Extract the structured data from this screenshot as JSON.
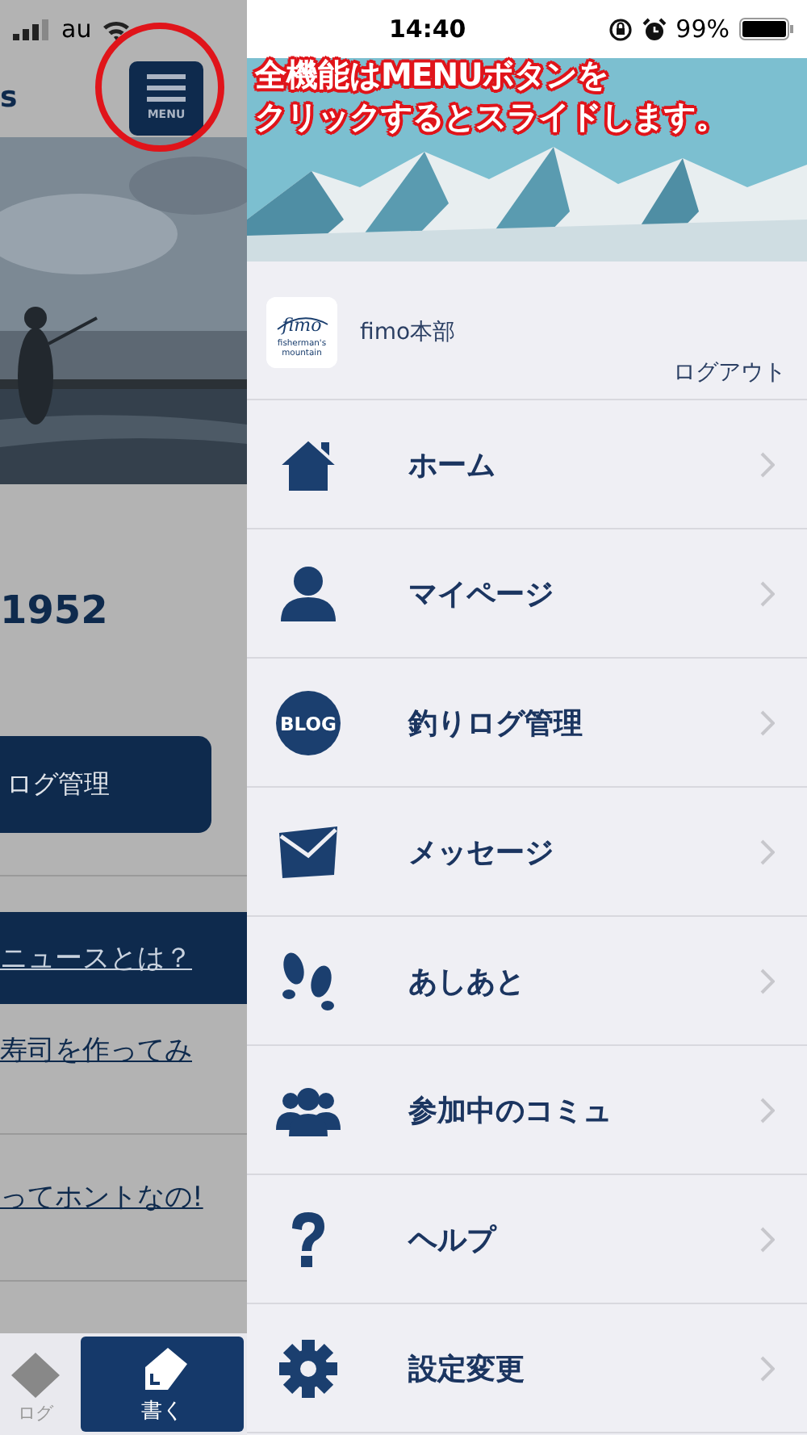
{
  "status_bar": {
    "carrier": "au",
    "time": "14:40",
    "battery": "99%"
  },
  "back_page": {
    "header_title": "s",
    "menu_button": "MENU",
    "number": "1952",
    "log_button": "ログ管理",
    "links": [
      {
        "text": "ニュースとは？",
        "highlighted": true
      },
      {
        "text": "寿司を作ってみ",
        "highlighted": false
      },
      {
        "text": "ってホントなの!",
        "highlighted": false
      }
    ],
    "tabs": [
      {
        "label": "ログ",
        "selected": false
      },
      {
        "label": "書く",
        "selected": true
      }
    ]
  },
  "annotation": {
    "lines": [
      "全機能はMENUボタンを",
      "クリックするとスライドします。"
    ]
  },
  "menu": {
    "logo": {
      "name": "fimo",
      "tagline": [
        "fisherman's",
        "mountain"
      ]
    },
    "user": "fimo本部",
    "logout": "ログアウト",
    "items": [
      {
        "label": "ホーム",
        "kind": "home"
      },
      {
        "label": "マイページ",
        "kind": "person"
      },
      {
        "label": "釣りログ管理",
        "kind": "badge",
        "icon_text": "BLOG"
      },
      {
        "label": "メッセージ",
        "kind": "envelope"
      },
      {
        "label": "あしあと",
        "kind": "footprints"
      },
      {
        "label": "参加中のコミュ",
        "kind": "group"
      },
      {
        "label": "ヘルプ",
        "kind": "question"
      },
      {
        "label": "設定変更",
        "kind": "gear"
      }
    ]
  }
}
